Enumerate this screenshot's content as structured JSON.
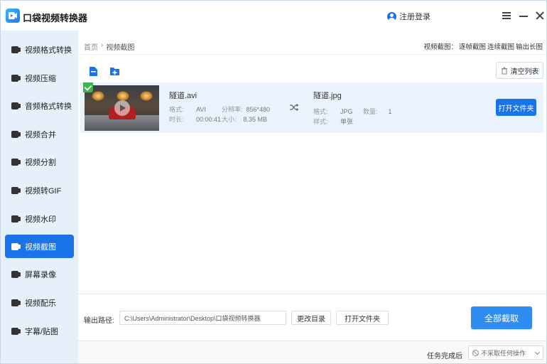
{
  "app": {
    "title": "口袋视频转换器",
    "login_label": "注册登录"
  },
  "sidebar": {
    "items": [
      {
        "label": "视频格式转换",
        "icon": "video-convert-icon"
      },
      {
        "label": "视频压缩",
        "icon": "compress-icon"
      },
      {
        "label": "音频格式转换",
        "icon": "audio-convert-icon"
      },
      {
        "label": "视频合并",
        "icon": "merge-icon"
      },
      {
        "label": "视频分割",
        "icon": "split-icon"
      },
      {
        "label": "视频转GIF",
        "icon": "gif-icon"
      },
      {
        "label": "视频水印",
        "icon": "watermark-icon"
      },
      {
        "label": "视频截图",
        "icon": "screenshot-icon"
      },
      {
        "label": "屏幕录像",
        "icon": "screen-record-icon"
      },
      {
        "label": "视频配乐",
        "icon": "music-icon"
      },
      {
        "label": "字幕/贴图",
        "icon": "subtitle-icon"
      }
    ],
    "active_index": 7
  },
  "breadcrumb": {
    "home": "首页",
    "separator": "›",
    "current": "视频截图"
  },
  "feature_links": {
    "prefix": "视频截图：",
    "items": [
      "逐帧截图",
      "连续截图",
      "输出长图"
    ]
  },
  "toolbar": {
    "clear_label": "清空列表"
  },
  "file": {
    "source": {
      "name": "隧道.avi",
      "format_label": "格式:",
      "format": "AVI",
      "resolution_label": "分辨率:",
      "resolution": "856*480",
      "duration_label": "时长:",
      "duration": "00:00:41",
      "size_label": "大小:",
      "size": "8.35 MB"
    },
    "output": {
      "name": "隧道.jpg",
      "format_label": "格式:",
      "format": "JPG",
      "count_label": "数量:",
      "count": "1",
      "style_label": "样式:",
      "style": "单张"
    },
    "open_folder_label": "打开文件夹"
  },
  "output_bar": {
    "path_label": "输出路径:",
    "path_value": "C:\\Users\\Administrator\\Desktop\\口袋视频转换器",
    "change_dir_label": "更改目录",
    "open_folder_label": "打开文件夹",
    "run_all_label": "全部截取"
  },
  "footer": {
    "after_task_label": "任务完成后",
    "after_task_value": "不采取任何操作"
  },
  "colors": {
    "accent": "#1a73e8",
    "sidebar_bg": "#e6f0fb",
    "row_bg": "#eaf3fd",
    "check_green": "#3bb54a"
  }
}
